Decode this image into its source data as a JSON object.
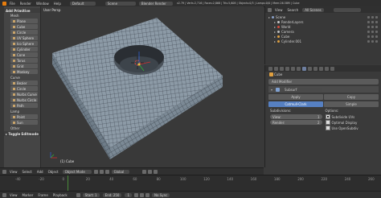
{
  "topbar": {
    "menus": [
      "File",
      "Render",
      "Window",
      "Help"
    ],
    "layout": "Default",
    "scene": "Scene",
    "engine": "Blender Render",
    "stats": "v2.79 | Verts:2,716 | Faces:2,868 | Tris:5,608 | Objects:0/3 | Lamps:0/0 | Mem:26.58M | Cube"
  },
  "left": {
    "add_primitive": "Add Primitive",
    "mesh_label": "Mesh",
    "mesh_tools": [
      "Plane",
      "Cube",
      "Circle",
      "UV Sphere",
      "Ico Sphere",
      "Cylinder",
      "Cone",
      "Torus",
      "Grid",
      "Monkey"
    ],
    "curve_label": "Curve",
    "curve_tools": [
      "Bezier",
      "Circle",
      "Nurbs Curve",
      "Nurbs Circle",
      "Path"
    ],
    "lamp_label": "Lamp",
    "lamp_tools": [
      "Point",
      "Sun"
    ],
    "other_label": "Other",
    "footer": "▸ Toggle Editmode"
  },
  "viewport": {
    "view_name": "User Persp",
    "selection": "(1) Cube"
  },
  "view_header": {
    "items": [
      "View",
      "Select",
      "Add",
      "Object"
    ],
    "mode": "Object Mode",
    "pivot": "Global"
  },
  "timeline": {
    "ticks": [
      "-40",
      "-20",
      "0",
      "20",
      "40",
      "60",
      "80",
      "100",
      "120",
      "140",
      "160",
      "180",
      "200",
      "220",
      "240",
      "260"
    ],
    "bar_items": [
      "View",
      "Marker",
      "Frame",
      "Playback"
    ],
    "start": "Start: 1",
    "end": "End: 250",
    "current": "1",
    "sync": "No Sync"
  },
  "outliner": {
    "header": [
      "View",
      "Search",
      "All Scenes"
    ],
    "rows": [
      {
        "label": "Scene",
        "indent": 0,
        "color": "#8aa0c8"
      },
      {
        "label": "RenderLayers",
        "indent": 1,
        "color": "#c8c8c8"
      },
      {
        "label": "World",
        "indent": 1,
        "color": "#d44b3b"
      },
      {
        "label": "Camera",
        "indent": 1,
        "color": "#c0c0c0"
      },
      {
        "label": "Cube",
        "indent": 1,
        "color": "#e0a040"
      },
      {
        "label": "Cylinder.001",
        "indent": 1,
        "color": "#e0a040"
      }
    ]
  },
  "props": {
    "object": "Cube",
    "add_modifier": "Add Modifier",
    "mod_name": "Subsurf",
    "apply": "Apply",
    "copy": "Copy",
    "catmull": "Catmull-Clark",
    "simple": "Simple",
    "subdivisions": "Subdivisions:",
    "options": "Options:",
    "view_label": "View:",
    "view_val": "1",
    "render_label": "Render:",
    "render_val": "2",
    "opt1": "Subdivide UVs",
    "opt2": "Optimal Display",
    "opt3": "Use OpenSubdiv"
  },
  "colors": {
    "accent": "#5680c2",
    "mesh_face": "#8c9aa6",
    "wire": "#2a2f36"
  }
}
